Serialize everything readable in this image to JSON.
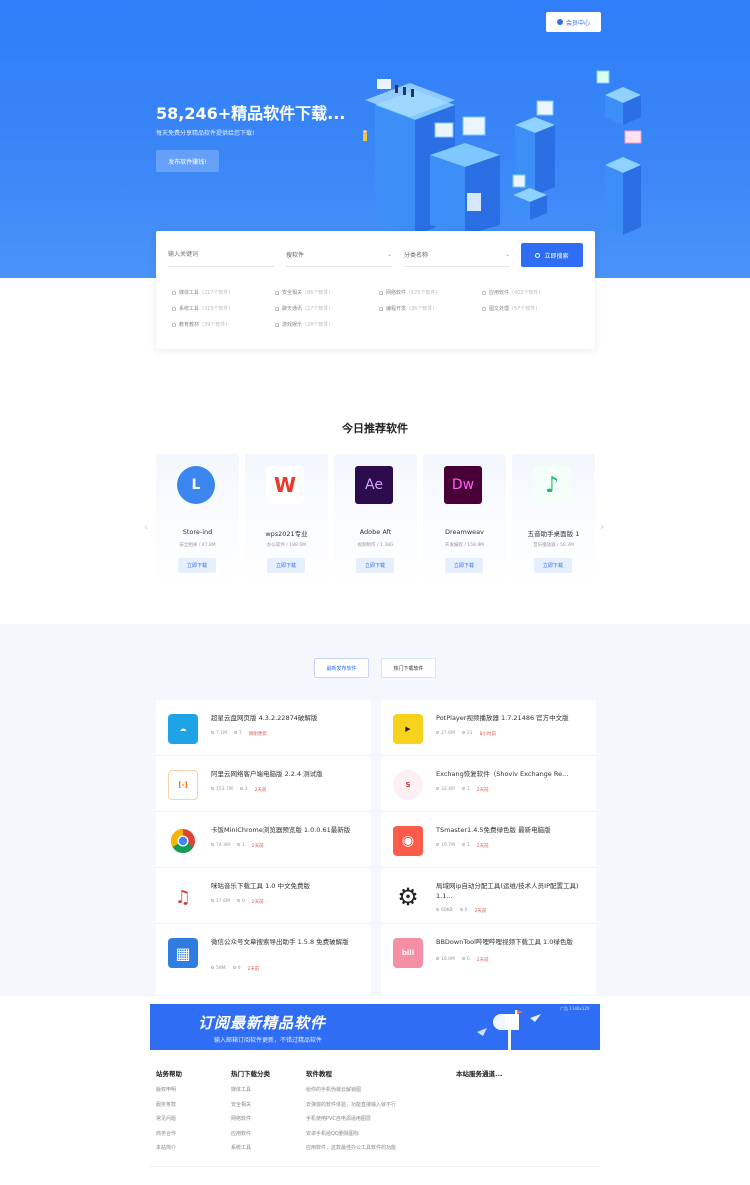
{
  "hero": {
    "login": "会员中心",
    "headline": "58,246+精品软件下载...",
    "subline": "每天免费分享精品软件提供给您下载!",
    "publish": "发布软件赚钱!"
  },
  "search": {
    "placeholder": "输入关键词",
    "select1": "搜软件",
    "select2": "分类名称",
    "button": "立即搜索",
    "categories": [
      {
        "name": "媒体工具",
        "count": "(217个软件)"
      },
      {
        "name": "安全相关",
        "count": "(86个软件)"
      },
      {
        "name": "网络软件",
        "count": "(125个软件)"
      },
      {
        "name": "应用软件",
        "count": "(402个软件)"
      },
      {
        "name": "系统工具",
        "count": "(315个软件)"
      },
      {
        "name": "聊天通讯",
        "count": "(27个软件)"
      },
      {
        "name": "编程开发",
        "count": "(36个软件)"
      },
      {
        "name": "图文处理",
        "count": "(57个软件)"
      },
      {
        "name": "教育教材",
        "count": "(39个软件)"
      },
      {
        "name": "游戏娱乐",
        "count": "(28个软件)"
      }
    ]
  },
  "recommend": {
    "title": "今日推荐软件",
    "prev": "‹",
    "next": "›",
    "items": [
      {
        "name": "Store-ind",
        "meta": "安全相关 / 47.8M",
        "btn": "立即下载",
        "logo": "L",
        "color": "#3a86ee"
      },
      {
        "name": "wps2021专业",
        "meta": "办公软件 / 188.0M",
        "btn": "立即下载",
        "logo": "W",
        "color": "#e8392b"
      },
      {
        "name": "Adobe Aft",
        "meta": "视频制作 / 1.38G",
        "btn": "立即下载",
        "logo": "Ae",
        "color": "#2d0c4e"
      },
      {
        "name": "Dreamweav",
        "meta": "开发编程 / 158.8M",
        "btn": "立即下载",
        "logo": "Dw",
        "color": "#470137"
      },
      {
        "name": "五音助手桌面版 1",
        "meta": "音乐播放器 / 50.3M",
        "btn": "立即下载",
        "logo": "♪",
        "color": "#23b86d"
      }
    ]
  },
  "latest": {
    "tab_new": "最新发布软件",
    "tab_hot": "热门下载软件",
    "left": [
      {
        "title": "超星云盘网页版 4.3.2.22874破解版",
        "size": "7.1M",
        "views": "7",
        "time": "刚刚更新",
        "icon": "cloud-icon",
        "bg": "#1ea3e6",
        "glyph": "☁"
      },
      {
        "title": "阿里云网络客户端电脑版 2.2.4 测试版",
        "size": "153.7M",
        "views": "3",
        "time": "2天前",
        "icon": "aliyun-icon",
        "bg": "#ff6a00",
        "glyph": "[-]"
      },
      {
        "title": "卡饭MiniChrome浏览器预览版 1.0.0.61最新版",
        "size": "74.3M",
        "views": "1",
        "time": "2天前",
        "icon": "chrome-icon",
        "bg": "#ffffff",
        "glyph": ""
      },
      {
        "title": "咪咕音乐下载工具 1.0 中文免费版",
        "size": "17.6M",
        "views": "0",
        "time": "2天前",
        "icon": "netease-music-icon",
        "bg": "#ffffff",
        "glyph": "♫"
      },
      {
        "title": "微信公众号文章搜索导出助手 1.5.8 免费破解版",
        "size": "58M",
        "views": "0",
        "time": "2天前",
        "icon": "grid-icon",
        "bg": "#2f7de1",
        "glyph": "▦"
      }
    ],
    "right": [
      {
        "title": "PotPlayer视频播放器 1.7.21486 官方中文版",
        "size": "27.6M",
        "views": "21",
        "time": "8小时前",
        "icon": "potplayer-icon",
        "bg": "#f7d21c",
        "glyph": "▶"
      },
      {
        "title": "Exchang恢复软件（Shoviv Exchange Re...",
        "size": "32.4M",
        "views": "1",
        "time": "2天前",
        "icon": "shoviv-icon",
        "bg": "#ffffff",
        "glyph": "S"
      },
      {
        "title": "TSmaster1.4.5免费绿色版 最新电脑版",
        "size": "19.7M",
        "views": "1",
        "time": "2天前",
        "icon": "fox-icon",
        "bg": "#ff5b4a",
        "glyph": "◉"
      },
      {
        "title": "局域网ip自动分配工具(运维/技术人员IP配置工具) 1.1...",
        "size": "60KB",
        "views": "0",
        "time": "2天前",
        "icon": "gear-icon",
        "bg": "#ffffff",
        "glyph": "⚙"
      },
      {
        "title": "BBDownTool哔哩哔哩视频下载工具 1.0绿色版",
        "size": "16.0M",
        "views": "0",
        "time": "2天前",
        "icon": "bilibili-icon",
        "bg": "#f48fa6",
        "glyph": "bili"
      }
    ]
  },
  "banner": {
    "big": "订阅最新精品软件",
    "small": "输入邮箱订阅软件更新，不错过精品软件",
    "ad": "广告 1140x120"
  },
  "footer": {
    "cols": [
      {
        "h": "站务帮助",
        "links": [
          "版权申明",
          "服务条款",
          "常见问题",
          "商务合作",
          "本站简介"
        ]
      },
      {
        "h": "热门下载分类",
        "links": [
          "媒体工具",
          "安全相关",
          "网络软件",
          "应用软件",
          "系统工具"
        ]
      },
      {
        "h": "软件教程",
        "links": [
          "给你的手机伪装云解锁图",
          "去弹窗的软件体验，功能直接输入就不行",
          "手机使用PVC自电源适用图层",
          "安卓手机给QQ删除图标",
          "应用软件，这款最佳办公工具软件的功能"
        ]
      },
      {
        "h": "本站服务通道...",
        "links": []
      }
    ]
  },
  "colors": {
    "primary": "#2f6ef4",
    "hero": "#3b87f7",
    "section_bg": "#f4f7fc"
  }
}
